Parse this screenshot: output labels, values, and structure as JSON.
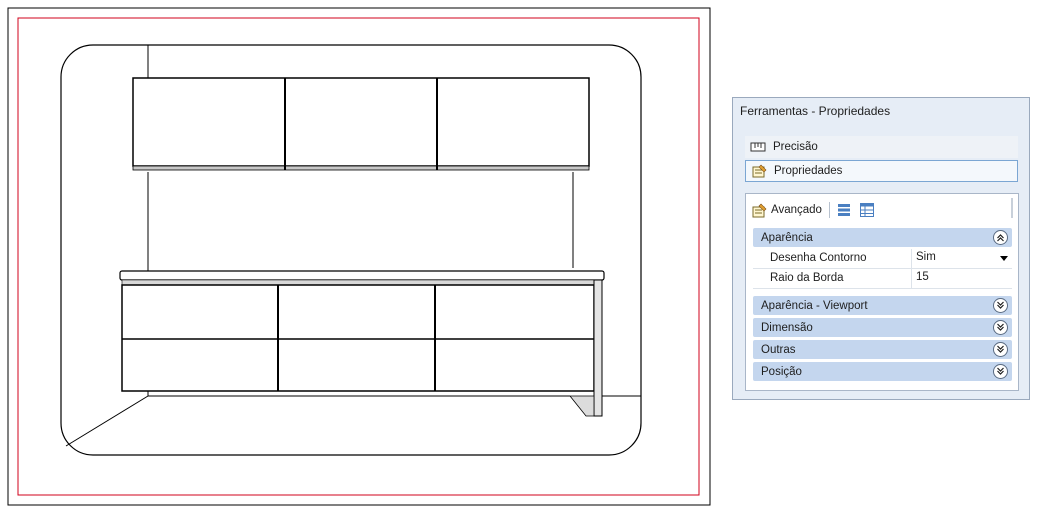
{
  "panel": {
    "title": "Ferramentas - Propriedades",
    "nav": [
      {
        "label": "Precisão",
        "icon": "precision-icon"
      },
      {
        "label": "Propriedades",
        "icon": "properties-icon"
      }
    ],
    "toolbar": {
      "label": "Avançado",
      "icons": [
        "advanced-properties-icon",
        "list-view-icon",
        "table-view-icon"
      ]
    },
    "categories": [
      {
        "label": "Aparência",
        "expanded": true
      },
      {
        "label": "Aparência - Viewport",
        "expanded": false
      },
      {
        "label": "Dimensão",
        "expanded": false
      },
      {
        "label": "Outras",
        "expanded": false
      },
      {
        "label": "Posição",
        "expanded": false
      }
    ],
    "properties": [
      {
        "name": "Desenha Contorno",
        "value": "Sim",
        "dropdown": true
      },
      {
        "name": "Raio da Borda",
        "value": "15",
        "dropdown": false
      }
    ]
  },
  "drawing": {
    "border_color": "#d0021b",
    "viewport_corner": "rounded",
    "subject": "kitchen cabinets elevation"
  }
}
